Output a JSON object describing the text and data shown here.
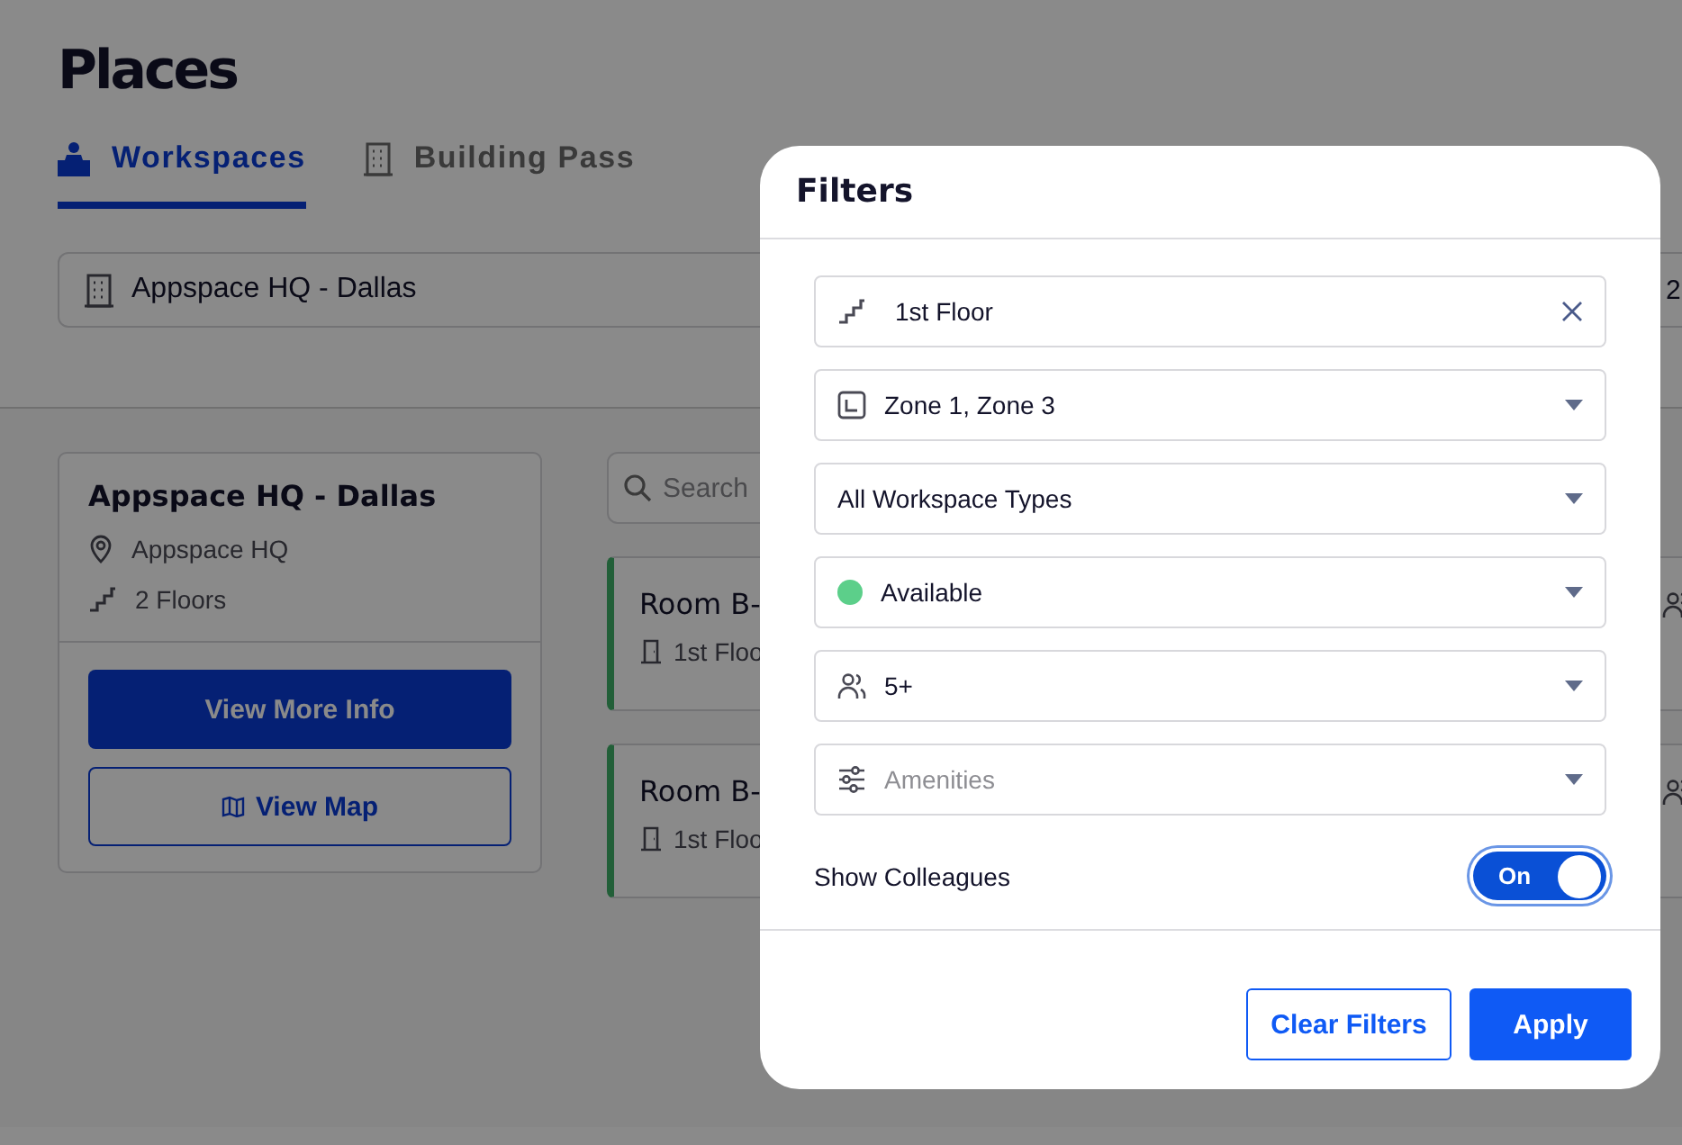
{
  "page": {
    "title": "Places"
  },
  "tabs": [
    {
      "label": "Workspaces",
      "selected": true
    },
    {
      "label": "Building Pass",
      "selected": false
    }
  ],
  "location_field": {
    "value": "Appspace HQ - Dallas"
  },
  "date_field": {
    "value": "2"
  },
  "building_card": {
    "name": "Appspace HQ - Dallas",
    "details": [
      "Appspace HQ",
      "2 Floors"
    ],
    "buttons": [
      {
        "label": "View More Info",
        "kind": "primary"
      },
      {
        "label": "View Map",
        "kind": "outline"
      }
    ]
  },
  "search": {
    "placeholder": "Search"
  },
  "rooms": [
    {
      "name": "Room B-",
      "floor": "1st Floo"
    },
    {
      "name": "Room B-",
      "floor": "1st Floo"
    }
  ],
  "filters": {
    "title": "Filters",
    "fields": [
      {
        "kind": "clearable",
        "value": "1st Floor"
      },
      {
        "kind": "dropdown",
        "value": "Zone 1, Zone 3"
      },
      {
        "kind": "dropdown",
        "value": "All Workspace Types"
      },
      {
        "kind": "dropdown",
        "color": "#5ccf8a",
        "value": "Available"
      },
      {
        "kind": "dropdown",
        "value": "5+"
      },
      {
        "kind": "dropdown",
        "placeholder": "Amenities"
      }
    ],
    "toggle": {
      "label": "Show Colleagues",
      "on": true,
      "state_text": "On"
    },
    "buttons": [
      {
        "label": "Clear Filters",
        "kind": "outline"
      },
      {
        "label": "Apply",
        "kind": "primary"
      }
    ]
  }
}
